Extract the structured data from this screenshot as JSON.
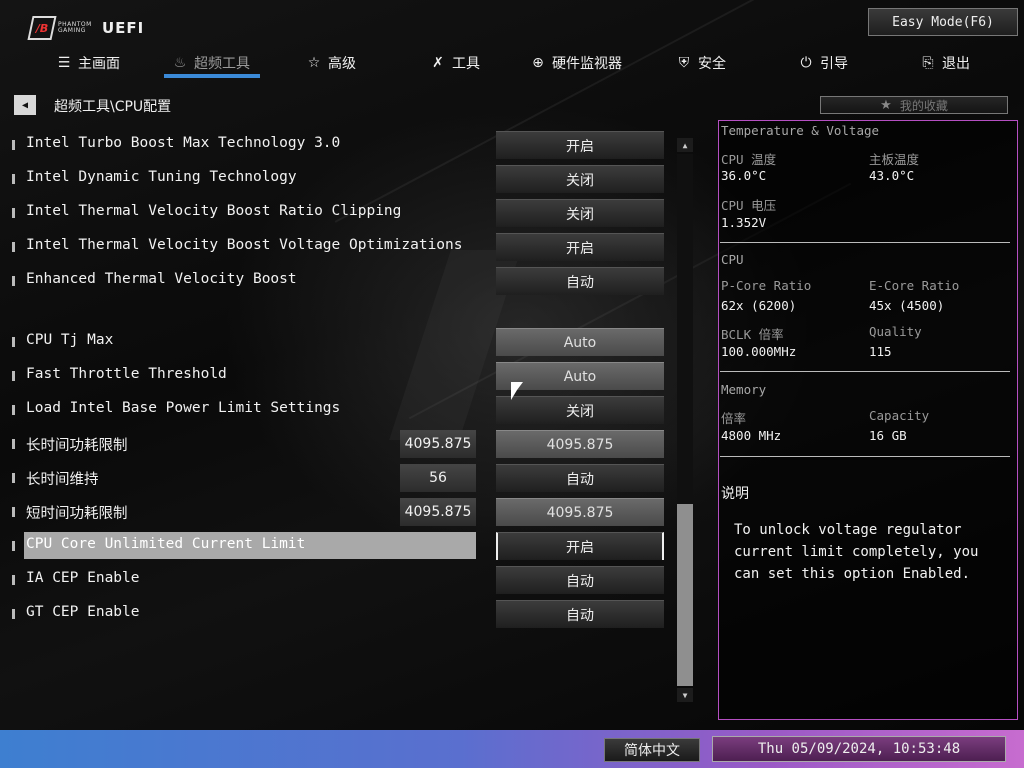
{
  "header": {
    "logo_small": "PHANTOM GAMING",
    "logo_text": "UEFI",
    "easy_mode": "Easy Mode(F6)"
  },
  "nav": [
    {
      "label": "主画面",
      "icon": "list-icon"
    },
    {
      "label": "超频工具",
      "icon": "flame-icon"
    },
    {
      "label": "高级",
      "icon": "star-icon"
    },
    {
      "label": "工具",
      "icon": "tools-icon"
    },
    {
      "label": "硬件监视器",
      "icon": "crosshair-icon"
    },
    {
      "label": "安全",
      "icon": "shield-icon"
    },
    {
      "label": "引导",
      "icon": "power-icon"
    },
    {
      "label": "退出",
      "icon": "exit-icon"
    }
  ],
  "breadcrumb": "超频工具\\CPU配置",
  "favorites": "我的收藏",
  "settings": [
    {
      "label": "Intel Turbo Boost Max Technology 3.0",
      "value": "开启"
    },
    {
      "label": "Intel Dynamic Tuning Technology",
      "value": "关闭"
    },
    {
      "label": "Intel Thermal Velocity Boost Ratio Clipping",
      "value": "关闭"
    },
    {
      "label": "Intel Thermal Velocity Boost Voltage Optimizations",
      "value": "开启"
    },
    {
      "label": "Enhanced Thermal Velocity Boost",
      "value": "自动"
    },
    {
      "label": "CPU Tj Max",
      "value": "Auto"
    },
    {
      "label": "Fast Throttle Threshold",
      "value": "Auto"
    },
    {
      "label": "Load Intel Base Power Limit Settings",
      "value": "关闭"
    },
    {
      "label": "长时间功耗限制",
      "current": "4095.875",
      "value": "4095.875"
    },
    {
      "label": "长时间维持",
      "current": "56",
      "value": "自动"
    },
    {
      "label": "短时间功耗限制",
      "current": "4095.875",
      "value": "4095.875"
    },
    {
      "label": "CPU Core Unlimited Current Limit",
      "value": "开启"
    },
    {
      "label": "IA CEP Enable",
      "value": "自动"
    },
    {
      "label": "GT CEP Enable",
      "value": "自动"
    }
  ],
  "panel": {
    "tv_title": "Temperature & Voltage",
    "cpu_temp_label": "CPU 温度",
    "cpu_temp": "36.0°C",
    "mb_temp_label": "主板温度",
    "mb_temp": "43.0°C",
    "cpu_volt_label": "CPU 电压",
    "cpu_volt": "1.352V",
    "cpu_title": "CPU",
    "pcore_label": "P-Core Ratio",
    "pcore": "62x (6200)",
    "ecore_label": "E-Core Ratio",
    "ecore": "45x (4500)",
    "bclk_label": "BCLK 倍率",
    "bclk": "100.000MHz",
    "quality_label": "Quality",
    "quality": "115",
    "mem_title": "Memory",
    "mem_rate_label": "倍率",
    "mem_rate": "4800 MHz",
    "capacity_label": "Capacity",
    "capacity": "16 GB",
    "desc_title": "说明",
    "desc_text": "To unlock voltage regulator current limit completely, you can set this option Enabled."
  },
  "footer": {
    "language": "简体中文",
    "datetime": "Thu 05/09/2024, 10:53:48"
  },
  "colors": {
    "accent_blue": "#3b8ad8",
    "panel_border": "#b54fc2",
    "footer_left": "#3e7fd0",
    "footer_right": "#c76ccf"
  }
}
